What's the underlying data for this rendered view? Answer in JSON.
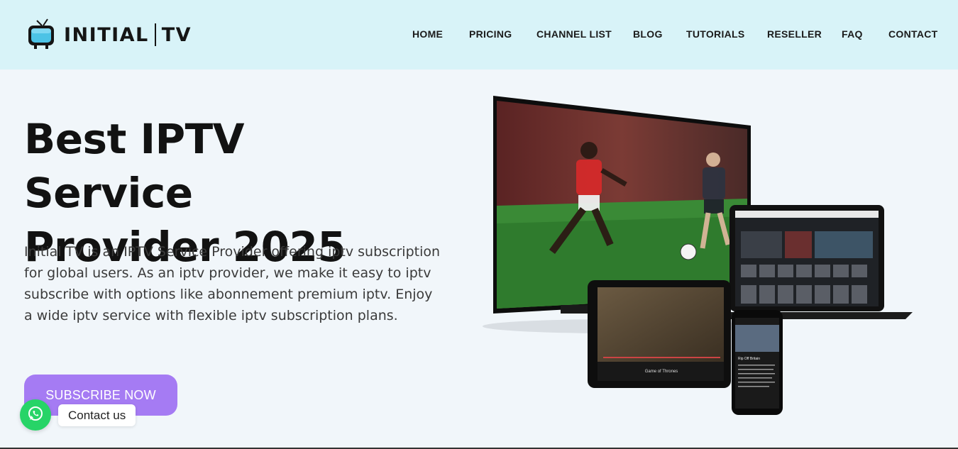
{
  "brand": {
    "name_left": "INITIAL",
    "name_right": "TV"
  },
  "nav": {
    "items": [
      {
        "label": "HOME"
      },
      {
        "label": "PRICING"
      },
      {
        "label": "CHANNEL LIST"
      },
      {
        "label": "BLOG"
      },
      {
        "label": "TUTORIALS"
      },
      {
        "label": "RESELLER"
      },
      {
        "label": "FAQ"
      },
      {
        "label": "CONTACT"
      }
    ]
  },
  "hero": {
    "title_line1": "Best IPTV Service",
    "title_line2": "Provider 2025",
    "description": "Initial TV is an IPTV Service Provider offering iptv subscription for global users. As an iptv provider, we make it easy to iptv subscribe with options like abonnement premium iptv. Enjoy a wide iptv service with flexible iptv subscription plans.",
    "cta_label": "SUBSCRIBE NOW"
  },
  "chat": {
    "label": "Contact us",
    "icon": "whatsapp-icon"
  },
  "devices_image": {
    "phone_title": "Rip Off Britain",
    "tablet_title": "Game of Thrones"
  },
  "colors": {
    "header_bg": "#d8f3f8",
    "page_bg": "#f1f6fa",
    "cta_bg": "#a57bf3",
    "whatsapp": "#27d467"
  }
}
